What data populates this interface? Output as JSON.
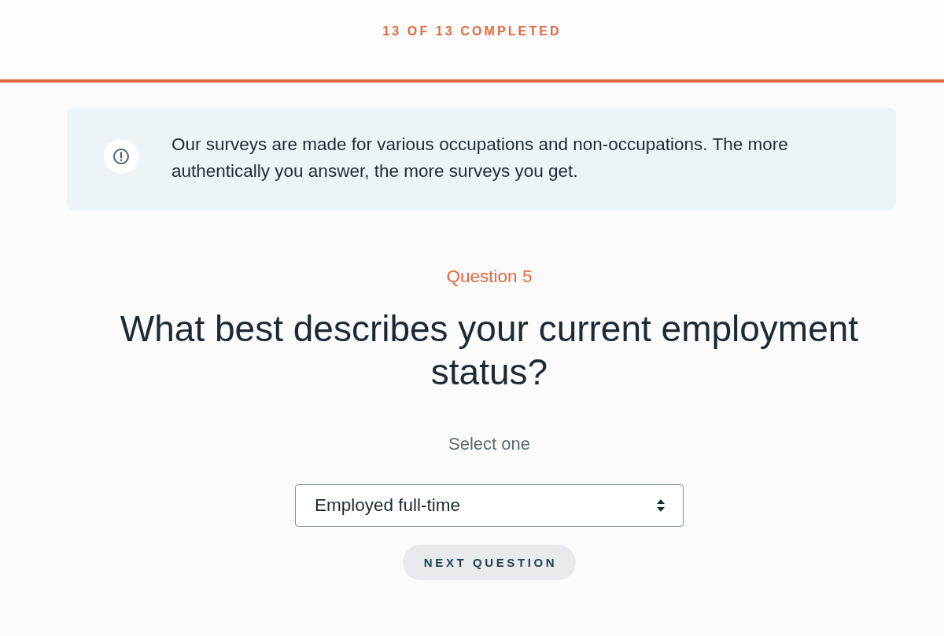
{
  "progress": {
    "label": "13 OF 13 COMPLETED",
    "level": 1
  },
  "notice": {
    "text": "Our surveys are made for various occupations and non-occupations. The more authentically you answer, the more surveys you get."
  },
  "question": {
    "number": "Question 5",
    "title": "What best describes your current employment status?",
    "instruction": "Select one"
  },
  "answer_select": {
    "value": "Employed full-time"
  },
  "buttons": [
    {
      "label": "NEXT QUESTION"
    }
  ]
}
